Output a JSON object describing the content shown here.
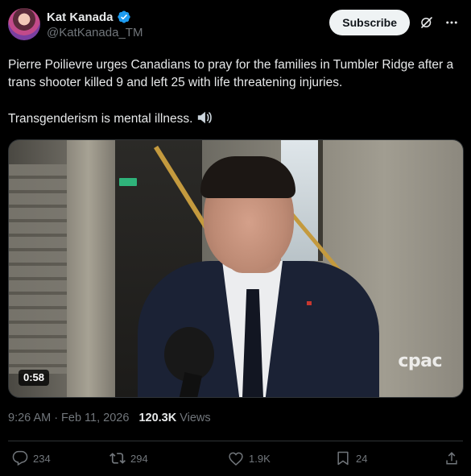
{
  "author": {
    "display_name": "Kat Kanada",
    "handle": "@KatKanada_TM",
    "verified": true
  },
  "header": {
    "subscribe_label": "Subscribe",
    "icons": [
      "grok-icon",
      "more-icon"
    ]
  },
  "tweet": {
    "line1": "Pierre Poilievre urges Canadians to pray for the families in Tumbler Ridge after a trans shooter killed 9 and left 25 with life threatening injuries.",
    "line2": "Transgenderism is mental illness.",
    "emoji": "speaker-icon"
  },
  "video": {
    "duration": "0:58",
    "watermark": "cpac"
  },
  "meta": {
    "time": "9:26 AM",
    "separator": "·",
    "date": "Feb 11, 2026",
    "views_count": "120.3K",
    "views_label": "Views"
  },
  "actions": {
    "replies": "234",
    "reposts": "294",
    "likes": "1.9K",
    "bookmarks": "24"
  },
  "colors": {
    "background": "#000000",
    "text": "#e7e9ea",
    "muted": "#71767b",
    "verified": "#1d9bf0",
    "divider": "#2f3336"
  }
}
